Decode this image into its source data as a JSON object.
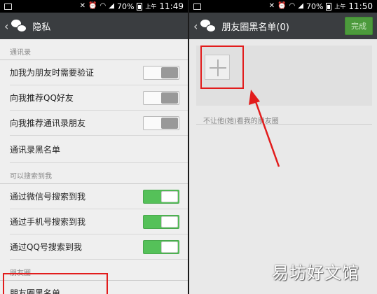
{
  "left": {
    "status": {
      "battery": "70%",
      "ampm": "上午",
      "time": "11:49"
    },
    "title": "隐私",
    "sections": {
      "contacts": {
        "header": "通讯录",
        "rows": [
          {
            "label": "加我为朋友时需要验证",
            "toggle": false
          },
          {
            "label": "向我推荐QQ好友",
            "toggle": false
          },
          {
            "label": "向我推荐通讯录朋友",
            "toggle": false
          },
          {
            "label": "通讯录黑名单"
          }
        ]
      },
      "searchable": {
        "header": "可以搜索到我",
        "rows": [
          {
            "label": "通过微信号搜索到我",
            "toggle": true
          },
          {
            "label": "通过手机号搜索到我",
            "toggle": true
          },
          {
            "label": "通过QQ号搜索到我",
            "toggle": true
          }
        ]
      },
      "moments": {
        "header": "朋友圈",
        "rows": [
          {
            "label": "朋友圈黑名单"
          }
        ]
      }
    }
  },
  "right": {
    "status": {
      "battery": "70%",
      "ampm": "上午",
      "time": "11:50"
    },
    "title": "朋友圈黑名单(0)",
    "done_label": "完成",
    "caption": "不让他(她)看我的朋友圈"
  },
  "watermark": "易坊好文馆",
  "colors": {
    "titlebar": "#3a3d40",
    "toggle_on": "#55c159",
    "highlight": "#e21c1c",
    "done": "#4c9a3c"
  }
}
